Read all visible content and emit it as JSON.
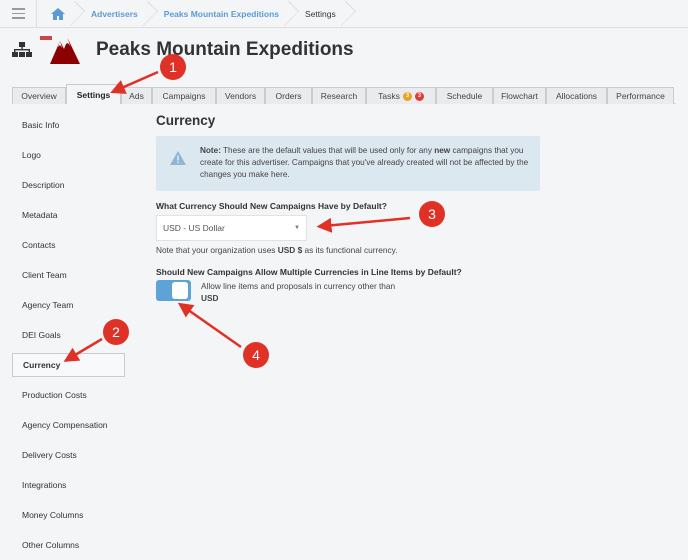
{
  "breadcrumb": {
    "items": [
      "Advertisers",
      "Peaks Mountain Expeditions"
    ],
    "current": "Settings"
  },
  "header": {
    "title": "Peaks Mountain Expeditions"
  },
  "tabs": [
    {
      "label": "Overview"
    },
    {
      "label": "Settings",
      "active": true
    },
    {
      "label": "Ads"
    },
    {
      "label": "Campaigns"
    },
    {
      "label": "Vendors"
    },
    {
      "label": "Orders"
    },
    {
      "label": "Research"
    },
    {
      "label": "Tasks",
      "badges": [
        "3",
        "3"
      ]
    },
    {
      "label": "Schedule"
    },
    {
      "label": "Flowchart"
    },
    {
      "label": "Allocations"
    },
    {
      "label": "Performance"
    }
  ],
  "sidebar": {
    "items": [
      "Basic Info",
      "Logo",
      "Description",
      "Metadata",
      "Contacts",
      "Client Team",
      "Agency Team",
      "DEI Goals",
      "Currency",
      "Production Costs",
      "Agency Compensation",
      "Delivery Costs",
      "Integrations",
      "Money Columns",
      "Other Columns"
    ],
    "active": "Currency"
  },
  "main": {
    "title": "Currency",
    "note": {
      "bold": "Note:",
      "t1": " These are the default values that will be used only for any ",
      "new": "new",
      "t2": " campaigns that you create for this advertiser. Campaigns that you've already created will not be affected by the changes you make here."
    },
    "currency_label": "What Currency Should New Campaigns Have by Default?",
    "currency_value": "USD - US Dollar",
    "functional_pre": "Note that your organization uses ",
    "functional_cur": "USD $",
    "functional_post": " as its functional currency.",
    "multi_label": "Should New Campaigns Allow Multiple Currencies in Line Items by Default?",
    "toggle_on": true,
    "toggle_text": "Allow line items and proposals in currency other than",
    "toggle_cur": "USD"
  },
  "annotations": [
    "1",
    "2",
    "3",
    "4"
  ],
  "colors": {
    "link": "#5b9bd5",
    "annotation": "#e03127",
    "toggle": "#5ea3d6",
    "badge_orange": "#f0a020",
    "badge_red": "#e53935"
  }
}
